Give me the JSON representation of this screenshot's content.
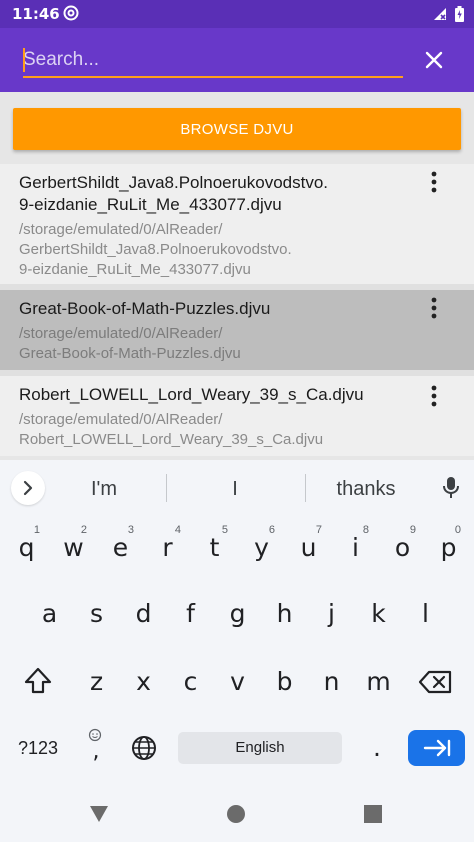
{
  "status_bar": {
    "time": "11:46"
  },
  "search": {
    "placeholder": "Search...",
    "value": ""
  },
  "browse_button": {
    "label": "BROWSE DJVU"
  },
  "files": [
    {
      "title": "GerbertShildt_Java8.Polnoerukovodstvo.9-eizdanie_RuLit_Me_433077.djvu",
      "title_lines": [
        "GerbertShildt_Java8.Polnoerukovodstvo.",
        "9-eizdanie_RuLit_Me_433077.djvu"
      ],
      "path_lines": [
        "/storage/emulated/0/AlReader/",
        "GerbertShildt_Java8.Polnoerukovodstvo.",
        "9-eizdanie_RuLit_Me_433077.djvu"
      ],
      "selected": false
    },
    {
      "title": "Great-Book-of-Math-Puzzles.djvu",
      "title_lines": [
        "Great-Book-of-Math-Puzzles.djvu"
      ],
      "path_lines": [
        "/storage/emulated/0/AlReader/",
        "Great-Book-of-Math-Puzzles.djvu"
      ],
      "selected": true
    },
    {
      "title": "Robert_LOWELL_Lord_Weary_39_s_Ca.djvu",
      "title_lines": [
        "Robert_LOWELL_Lord_Weary_39_s_Ca.djvu"
      ],
      "path_lines": [
        "/storage/emulated/0/AlReader/",
        "Robert_LOWELL_Lord_Weary_39_s_Ca.djvu"
      ],
      "selected": false
    }
  ],
  "keyboard": {
    "suggestions": [
      "I'm",
      "I",
      "thanks"
    ],
    "row1": [
      "q",
      "w",
      "e",
      "r",
      "t",
      "y",
      "u",
      "i",
      "o",
      "p"
    ],
    "row1_hints": [
      "1",
      "2",
      "3",
      "4",
      "5",
      "6",
      "7",
      "8",
      "9",
      "0"
    ],
    "row2": [
      "a",
      "s",
      "d",
      "f",
      "g",
      "h",
      "j",
      "k",
      "l"
    ],
    "row3": [
      "z",
      "x",
      "c",
      "v",
      "b",
      "n",
      "m"
    ],
    "symbols_label": "?123",
    "space_label": "English",
    "comma": ",",
    "period": "."
  },
  "colors": {
    "status_bar": "#5a2fb6",
    "app_bar": "#6838c9",
    "accent": "#ff9800",
    "selected_row": "#bdbdbd",
    "enter_key": "#1a73e8"
  }
}
